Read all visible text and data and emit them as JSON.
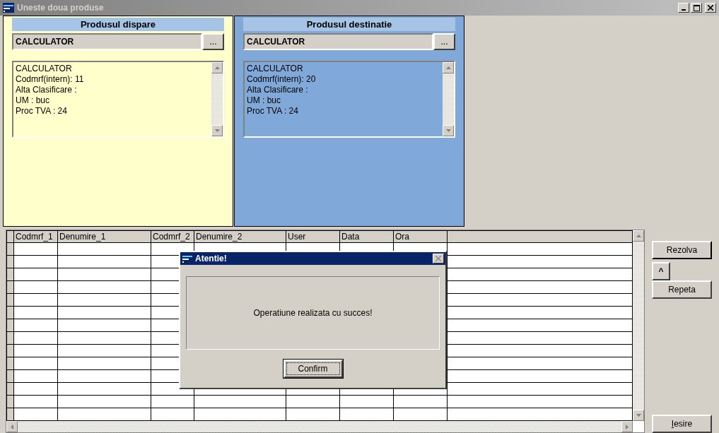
{
  "window": {
    "title": "Uneste doua produse"
  },
  "panels": [
    {
      "title": "Produsul dispare",
      "color": "#ffffcc",
      "product": "CALCULATOR",
      "browse_button": "...",
      "details": [
        "CALCULATOR",
        "Codmrf(intern): 11",
        "Alta Clasificare :",
        "UM : buc",
        "Proc TVA : 24"
      ]
    },
    {
      "title": "Produsul destinatie",
      "color": "#80a8d8",
      "product": "CALCULATOR",
      "browse_button": "...",
      "details": [
        "CALCULATOR",
        "Codmrf(intern): 20",
        "Alta Clasificare :",
        "UM : buc",
        "Proc TVA : 24"
      ]
    }
  ],
  "table": {
    "columns": [
      "Codmrf_1",
      "Denumire_1",
      "Codmrf_2",
      "Denumire_2",
      "User",
      "Data",
      "Ora"
    ]
  },
  "buttons": {
    "resolve": "Rezolva",
    "up": "^",
    "repeat": "Repeta",
    "exit": "Iesire"
  },
  "dialog": {
    "title": "Atentie!",
    "message": "Operatiune realizata cu succes!",
    "button": "Confirm"
  }
}
